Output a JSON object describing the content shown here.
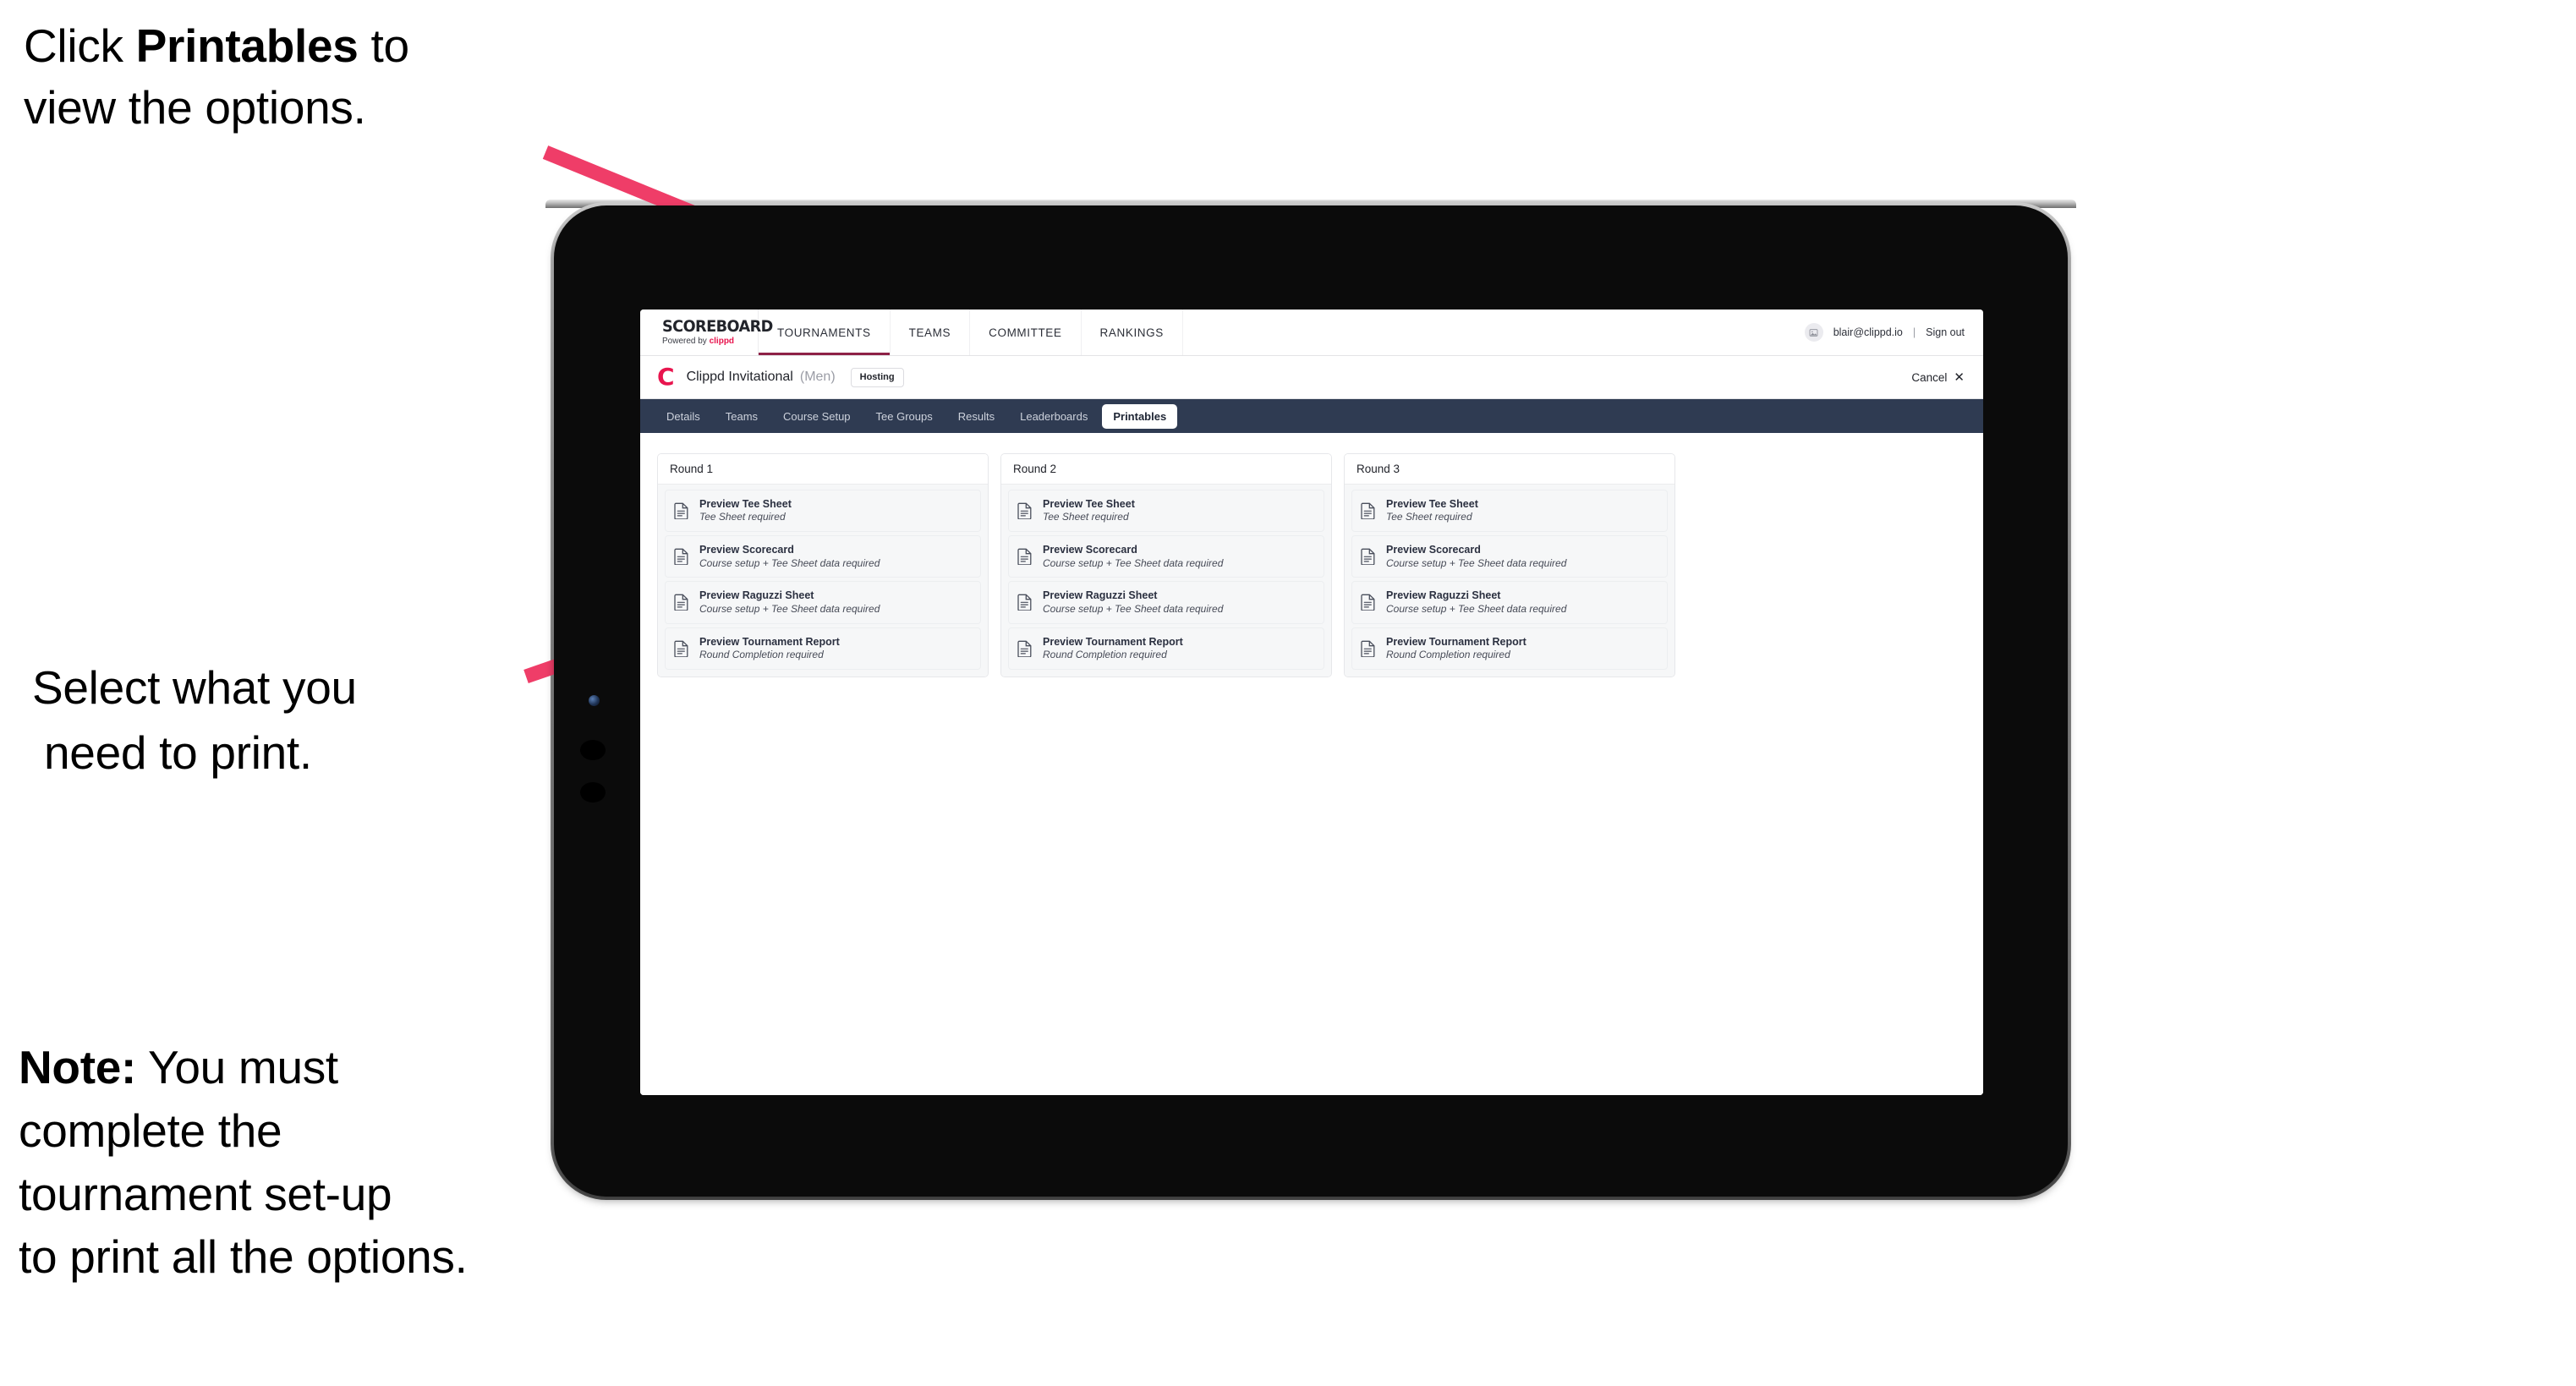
{
  "annotations": {
    "click_line1_pre": "Click ",
    "click_line1_bold": "Printables",
    "click_line1_post": " to",
    "click_line2": "view the options.",
    "select_line1": "Select what you",
    "select_line2": "need to print.",
    "note_bold": "Note:",
    "note_line1": " You must",
    "note_line2": "complete the",
    "note_line3": "tournament set-up",
    "note_line4": "to print all the options."
  },
  "colors": {
    "accent_pink": "#ef3d68",
    "brand_red": "#e8154e",
    "tabbar_navy": "#2f3b52",
    "active_underline": "#8e2146"
  },
  "topbar": {
    "brand_title": "SCOREBOARD",
    "brand_sub_pre": "Powered by ",
    "brand_sub_brand": "clippd",
    "nav": [
      {
        "label": "TOURNAMENTS",
        "active": true
      },
      {
        "label": "TEAMS",
        "active": false
      },
      {
        "label": "COMMITTEE",
        "active": false
      },
      {
        "label": "RANKINGS",
        "active": false
      }
    ],
    "avatar_icon": "user-avatar-icon",
    "user_email": "blair@clippd.io",
    "separator": "|",
    "sign_out": "Sign out"
  },
  "tournament_header": {
    "logo_letter": "C",
    "name": "Clippd Invitational",
    "gender": "(Men)",
    "status_badge": "Hosting",
    "cancel_label": "Cancel",
    "cancel_icon": "close-icon"
  },
  "tabs": [
    {
      "label": "Details",
      "active": false
    },
    {
      "label": "Teams",
      "active": false
    },
    {
      "label": "Course Setup",
      "active": false
    },
    {
      "label": "Tee Groups",
      "active": false
    },
    {
      "label": "Results",
      "active": false
    },
    {
      "label": "Leaderboards",
      "active": false
    },
    {
      "label": "Printables",
      "active": true
    }
  ],
  "rounds": [
    {
      "title": "Round 1",
      "items": [
        {
          "title": "Preview Tee Sheet",
          "sub": "Tee Sheet required",
          "icon": "document-icon"
        },
        {
          "title": "Preview Scorecard",
          "sub": "Course setup + Tee Sheet data required",
          "icon": "document-icon"
        },
        {
          "title": "Preview Raguzzi Sheet",
          "sub": "Course setup + Tee Sheet data required",
          "icon": "document-icon"
        },
        {
          "title": "Preview Tournament Report",
          "sub": "Round Completion required",
          "icon": "document-icon"
        }
      ]
    },
    {
      "title": "Round 2",
      "items": [
        {
          "title": "Preview Tee Sheet",
          "sub": "Tee Sheet required",
          "icon": "document-icon"
        },
        {
          "title": "Preview Scorecard",
          "sub": "Course setup + Tee Sheet data required",
          "icon": "document-icon"
        },
        {
          "title": "Preview Raguzzi Sheet",
          "sub": "Course setup + Tee Sheet data required",
          "icon": "document-icon"
        },
        {
          "title": "Preview Tournament Report",
          "sub": "Round Completion required",
          "icon": "document-icon"
        }
      ]
    },
    {
      "title": "Round 3",
      "items": [
        {
          "title": "Preview Tee Sheet",
          "sub": "Tee Sheet required",
          "icon": "document-icon"
        },
        {
          "title": "Preview Scorecard",
          "sub": "Course setup + Tee Sheet data required",
          "icon": "document-icon"
        },
        {
          "title": "Preview Raguzzi Sheet",
          "sub": "Course setup + Tee Sheet data required",
          "icon": "document-icon"
        },
        {
          "title": "Preview Tournament Report",
          "sub": "Round Completion required",
          "icon": "document-icon"
        }
      ]
    }
  ]
}
